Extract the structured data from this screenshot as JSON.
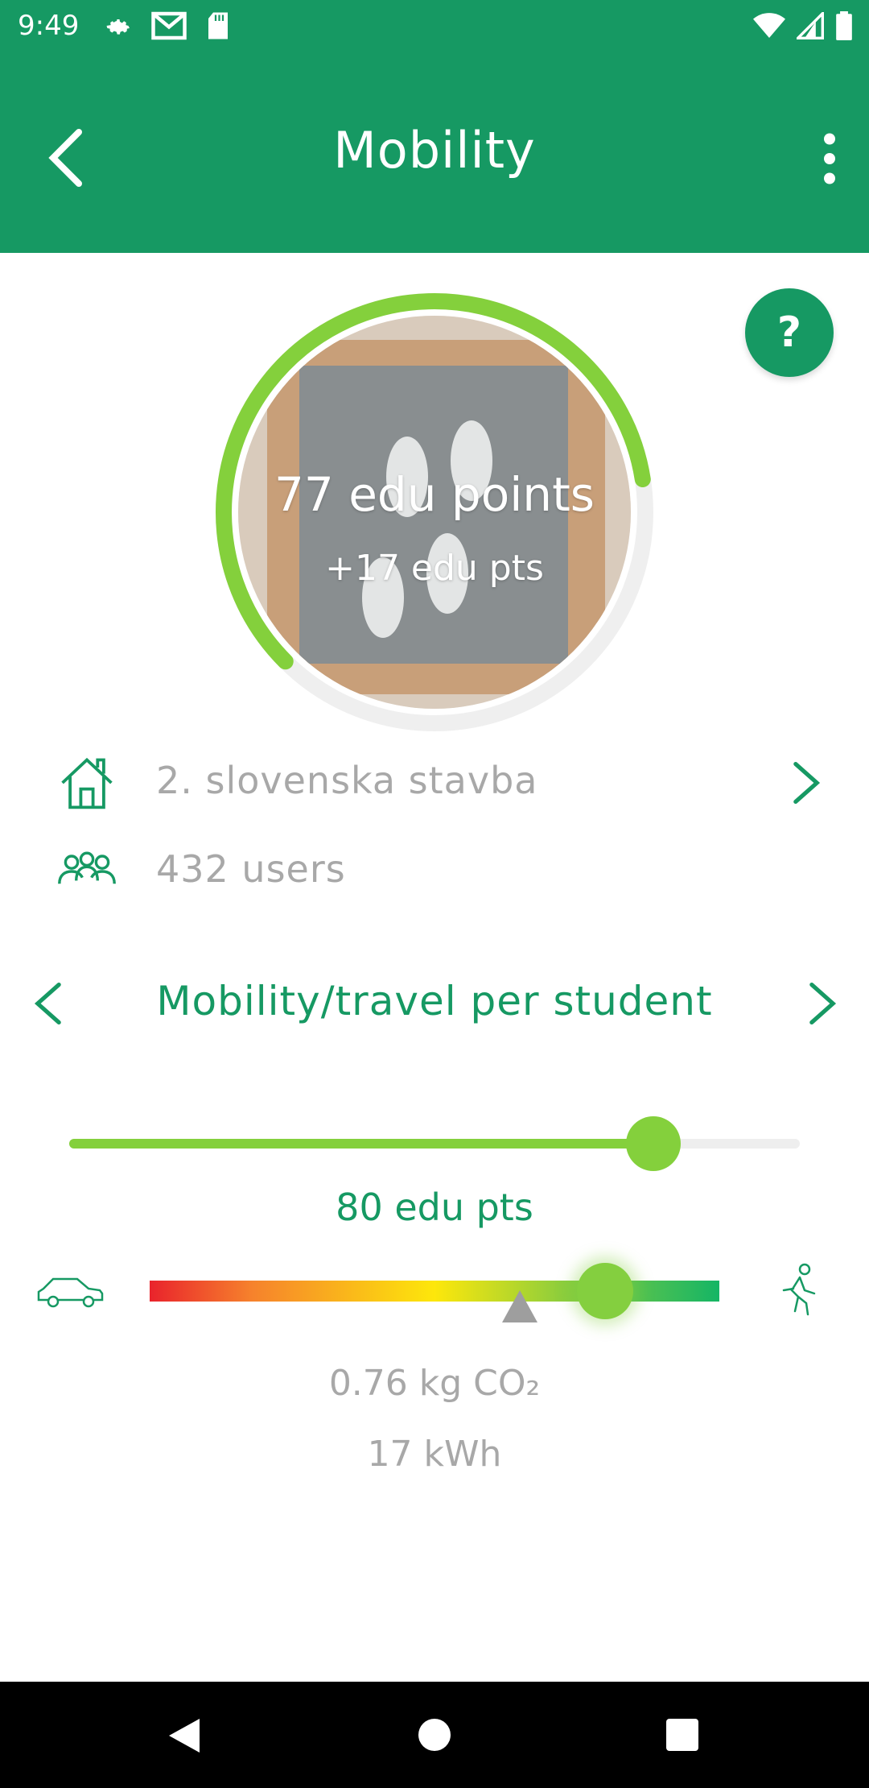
{
  "status_bar": {
    "time": "9:49",
    "left_icons": [
      "settings-icon",
      "gmail-icon",
      "sd-card-icon"
    ],
    "right_icons": [
      "wifi-icon",
      "cell-signal-icon",
      "battery-icon"
    ]
  },
  "app_bar": {
    "title": "Mobility",
    "back_icon": "chevron-left-icon",
    "menu_icon": "more-vert-icon"
  },
  "help_button": {
    "label": "?"
  },
  "score": {
    "points": "77 edu points",
    "delta": "+17 edu pts",
    "ring_progress": 0.6,
    "ring_color": "#84d03c",
    "track_color": "#efefef"
  },
  "info": {
    "building": "2. slovenska stavba",
    "users": "432 users"
  },
  "category": {
    "title": "Mobility/travel per student"
  },
  "points_slider": {
    "label": "80 edu pts",
    "value": 0.8
  },
  "co2_scale": {
    "current_value": 0.8,
    "average_value": 0.65,
    "left_icon": "car-icon",
    "right_icon": "walking-icon"
  },
  "metrics": {
    "co2": "0.76 kg CO₂",
    "energy": "17 kWh"
  },
  "colors": {
    "primary": "#169963",
    "accent": "#84d03c",
    "muted_text": "#a8a8a8"
  }
}
